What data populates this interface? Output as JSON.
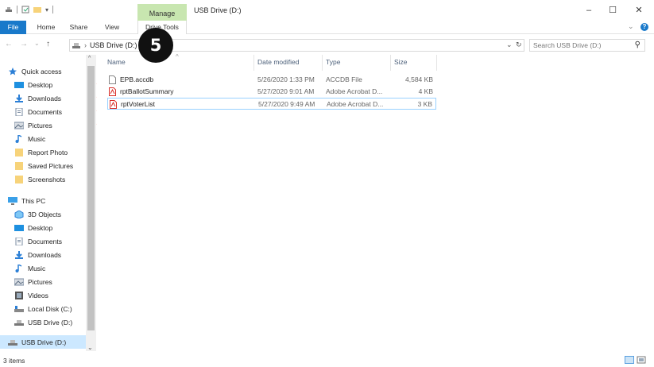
{
  "window": {
    "title": "USB Drive (D:)",
    "manage_tab": "Manage",
    "minimize": "–",
    "maximize": "☐",
    "close": "✕"
  },
  "ribbon": {
    "tabs": [
      {
        "label": "File"
      },
      {
        "label": "Home"
      },
      {
        "label": "Share"
      },
      {
        "label": "View"
      },
      {
        "label": "Drive Tools"
      }
    ]
  },
  "nav": {
    "back": "←",
    "forward": "→",
    "recent": "⌄",
    "up": "↑",
    "address_path": "USB Drive (D:)",
    "address_separator": "›",
    "refresh": "↻",
    "dropdown": "⌄",
    "search_placeholder": "Search USB Drive (D:)",
    "search_icon": "⚲"
  },
  "sidebar": {
    "items": [
      {
        "label": "Quick access",
        "icon": "star-icon",
        "pinned": false
      },
      {
        "label": "Desktop",
        "icon": "desktop-icon",
        "pinned": true
      },
      {
        "label": "Downloads",
        "icon": "downloads-icon",
        "pinned": true
      },
      {
        "label": "Documents",
        "icon": "documents-icon",
        "pinned": true
      },
      {
        "label": "Pictures",
        "icon": "pictures-icon",
        "pinned": true
      },
      {
        "label": "Music",
        "icon": "music-icon",
        "pinned": false
      },
      {
        "label": "Report Photo",
        "icon": "folder-icon",
        "pinned": false
      },
      {
        "label": "Saved Pictures",
        "icon": "folder-icon",
        "pinned": false
      },
      {
        "label": "Screenshots",
        "icon": "folder-icon",
        "pinned": false
      },
      {
        "label": "This PC",
        "icon": "computer-icon",
        "pinned": false
      },
      {
        "label": "3D Objects",
        "icon": "3d-objects-icon",
        "pinned": false
      },
      {
        "label": "Desktop",
        "icon": "desktop-icon",
        "pinned": false
      },
      {
        "label": "Documents",
        "icon": "documents-icon",
        "pinned": false
      },
      {
        "label": "Downloads",
        "icon": "downloads-icon",
        "pinned": false
      },
      {
        "label": "Music",
        "icon": "music-icon",
        "pinned": false
      },
      {
        "label": "Pictures",
        "icon": "pictures-icon",
        "pinned": false
      },
      {
        "label": "Videos",
        "icon": "videos-icon",
        "pinned": false
      },
      {
        "label": "Local Disk (C:)",
        "icon": "local-disk-icon",
        "pinned": false
      },
      {
        "label": "USB Drive (D:)",
        "icon": "usb-drive-icon",
        "pinned": false
      },
      {
        "label": "USB Drive (D:)",
        "icon": "usb-drive-icon",
        "pinned": false
      }
    ]
  },
  "columns": {
    "name": "Name",
    "date": "Date modified",
    "type": "Type",
    "size": "Size"
  },
  "files": [
    {
      "name": "EPB.accdb",
      "date": "5/26/2020 1:33 PM",
      "type": "ACCDB File",
      "size": "4,584 KB",
      "icon": "file-icon"
    },
    {
      "name": "rptBallotSummary",
      "date": "5/27/2020 9:01 AM",
      "type": "Adobe Acrobat D...",
      "size": "4 KB",
      "icon": "pdf-icon"
    },
    {
      "name": "rptVoterList",
      "date": "5/27/2020 9:49 AM",
      "type": "Adobe Acrobat D...",
      "size": "3 KB",
      "icon": "pdf-icon"
    }
  ],
  "status": {
    "item_count": "3 items"
  },
  "overlay": {
    "step_number": "5"
  },
  "colors": {
    "accent": "#1979ca",
    "manage_tab": "#c8e6b0",
    "selection_border": "#99d1ff",
    "folder": "#f7d37a",
    "pdf": "#d9302a"
  }
}
